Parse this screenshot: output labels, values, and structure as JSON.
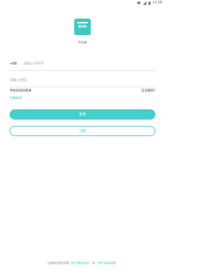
{
  "status_bar": {
    "time": "11:58"
  },
  "app": {
    "name": "家长端",
    "logo_text": "爱学校"
  },
  "login": {
    "country_code": "+86",
    "phone_placeholder": "请输入手机号",
    "password_placeholder": "请输入密码",
    "sms_login_label": "手机验证码登录",
    "forgot_password_label": "忘记密码?",
    "switch_role_label": "切换角色",
    "login_button": "登录",
    "register_button": "注册"
  },
  "footer": {
    "prefix": "注册即代表您同意",
    "user_agreement": "《用户服务协议》",
    "conjunction": "和",
    "privacy_policy": "《用户隐私政策》"
  },
  "colors": {
    "accent": "#45cfcb",
    "text": "#333333",
    "muted": "#aaaaaa"
  }
}
